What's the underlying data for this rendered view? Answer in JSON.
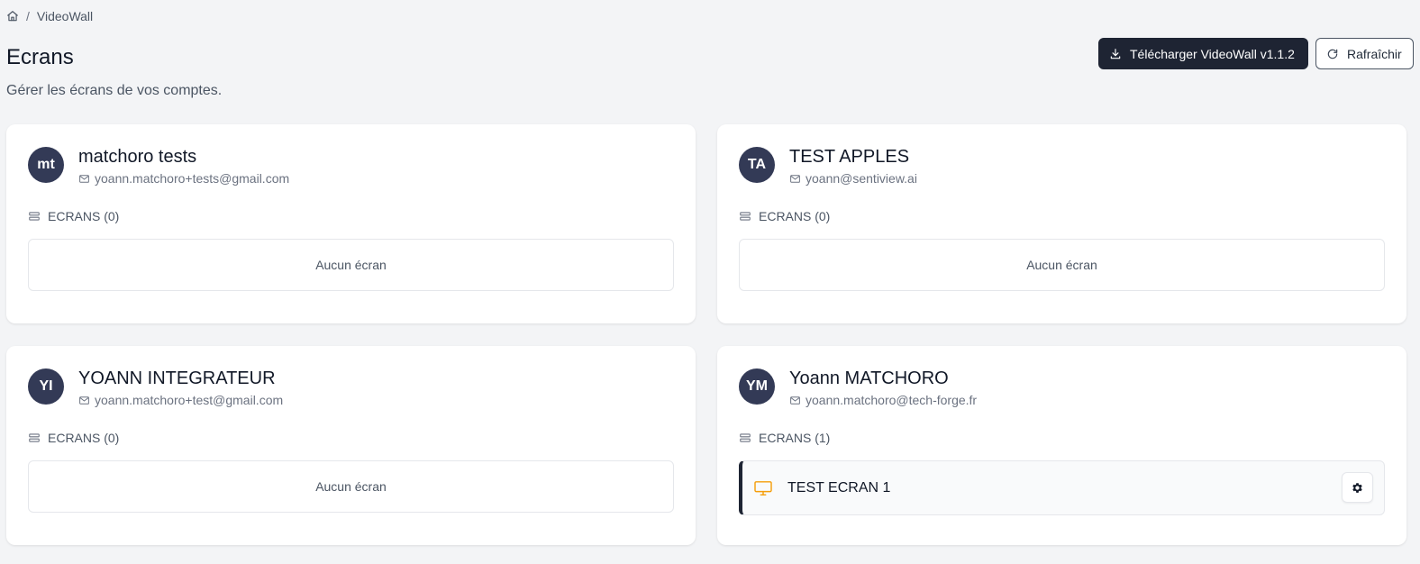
{
  "breadcrumb": {
    "current": "VideoWall"
  },
  "header": {
    "title": "Ecrans",
    "subtitle": "Gérer les écrans de vos comptes.",
    "download_label": "Télécharger VideoWall v1.1.2",
    "refresh_label": "Rafraîchir"
  },
  "accounts": [
    {
      "initials": "mt",
      "name": "matchoro tests",
      "email": "yoann.matchoro+tests@gmail.com",
      "screens_label": "ECRANS (0)",
      "empty_label": "Aucun écran"
    },
    {
      "initials": "TA",
      "name": "TEST APPLES",
      "email": "yoann@sentiview.ai",
      "screens_label": "ECRANS (0)",
      "empty_label": "Aucun écran"
    },
    {
      "initials": "YI",
      "name": "YOANN INTEGRATEUR",
      "email": "yoann.matchoro+test@gmail.com",
      "screens_label": "ECRANS (0)",
      "empty_label": "Aucun écran"
    },
    {
      "initials": "YM",
      "name": "Yoann MATCHORO",
      "email": "yoann.matchoro@tech-forge.fr",
      "screens_label": "ECRANS (1)",
      "screens": [
        {
          "name": "TEST ECRAN 1",
          "icon": "monitor-icon",
          "status_color": "#f59e0b"
        }
      ]
    }
  ],
  "colors": {
    "primary_dark": "#1e2433",
    "avatar_bg": "#333a56",
    "monitor_accent": "#f59e0b",
    "background": "#f3f4f6"
  }
}
